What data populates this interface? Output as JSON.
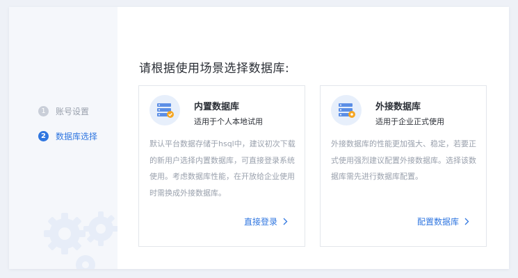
{
  "sidebar": {
    "steps": [
      {
        "number": "1",
        "label": "账号设置",
        "state": "inactive"
      },
      {
        "number": "2",
        "label": "数据库选择",
        "state": "active"
      }
    ]
  },
  "main": {
    "title": "请根据使用场景选择数据库:",
    "cards": [
      {
        "name": "内置数据库",
        "subtitle": "适用于个人本地试用",
        "description": "默认平台数据存储于hsql中，建议初次下载的新用户选择内置数据库，可直接登录系统使用。考虑数据库性能，在开放给企业使用时需换成外接数据库。",
        "action": "直接登录",
        "icon": "database-check-icon"
      },
      {
        "name": "外接数据库",
        "subtitle": "适用于企业正式使用",
        "description": "外接数据库的性能更加强大、稳定，若要正式使用强烈建议配置外接数据库。选择该数据库需先进行数据库配置。",
        "action": "配置数据库",
        "icon": "database-external-icon"
      }
    ]
  },
  "colors": {
    "accent": "#2f76e0",
    "badge_orange": "#f5a623",
    "muted_text": "#9aa1ad"
  }
}
